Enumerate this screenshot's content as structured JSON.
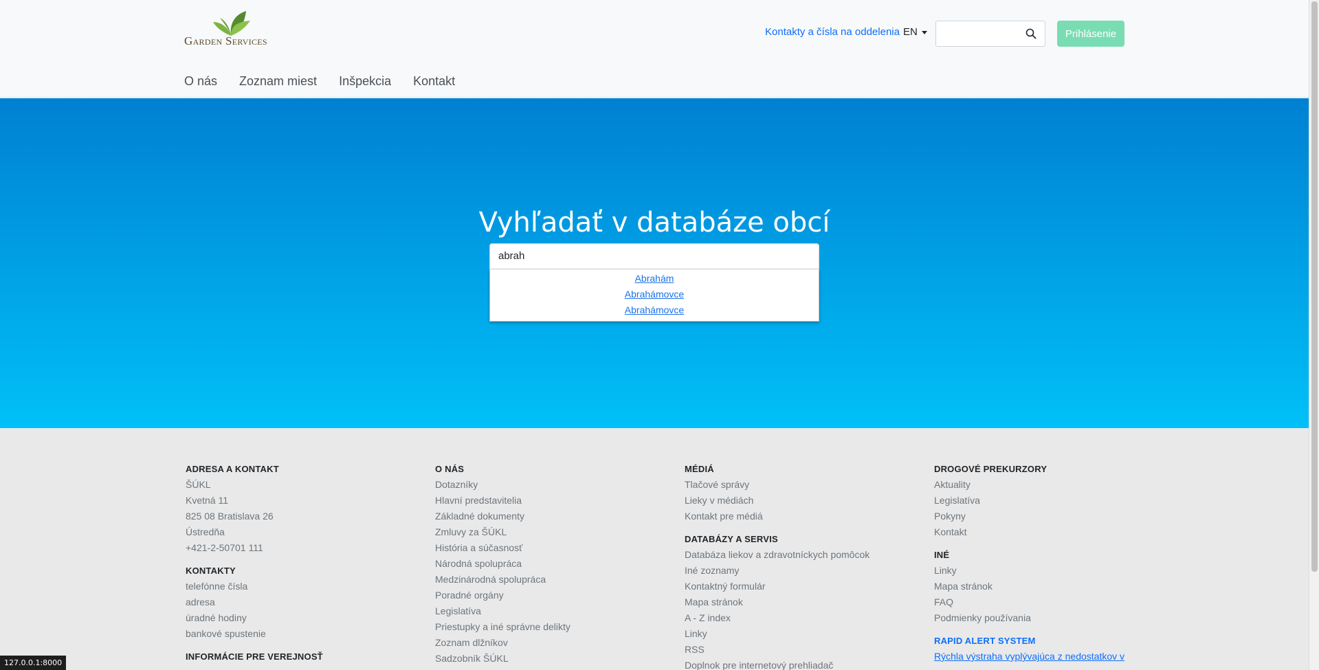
{
  "brand": {
    "logo_text": "Garden Services"
  },
  "header": {
    "contacts_link": "Kontakty a čísla na oddelenia",
    "language": "EN",
    "search_placeholder": "",
    "login_label": "Prihlásenie"
  },
  "nav": {
    "items": [
      "O nás",
      "Zoznam miest",
      "Inšpekcia",
      "Kontakt"
    ]
  },
  "hero": {
    "title": "Vyhľadať v databáze obcí",
    "search_value": "abrah",
    "suggestions": [
      "Abrahám",
      "Abrahámovce",
      "Abrahámovce"
    ]
  },
  "footer": {
    "col1": {
      "group1": {
        "title": "ADRESA A KONTAKT",
        "items": [
          "ŠÚKL",
          "Kvetná 11",
          "825 08 Bratislava 26",
          "Ústredňa",
          "+421-2-50701 111"
        ]
      },
      "group2": {
        "title": "KONTAKTY",
        "items": [
          "telefónne čísla",
          "adresa",
          "úradné hodiny",
          "bankové spustenie"
        ]
      },
      "group3": {
        "title": "INFORMÁCIE PRE VEREJNOSŤ"
      }
    },
    "col2": {
      "group1": {
        "title": "O NÁS",
        "items": [
          "Dotazníky",
          "Hlavní predstavitelia",
          "Základné dokumenty",
          "Zmluvy za ŠÚKL",
          "História a súčasnosť",
          "Národná spolupráca",
          "Medzinárodná spolupráca",
          "Poradné orgány",
          "Legislatíva",
          "Priestupky a iné správne delikty",
          "Zoznam dlžníkov",
          "Sadzobník ŠÚKL"
        ]
      }
    },
    "col3": {
      "group1": {
        "title": "MÉDIÁ",
        "items": [
          "Tlačové správy",
          "Lieky v médiách",
          "Kontakt pre médiá"
        ]
      },
      "group2": {
        "title": "DATABÁZY A SERVIS",
        "items": [
          "Databáza liekov a zdravotníckych pomôcok",
          "Iné zoznamy",
          "Kontaktný formulár",
          "Mapa stránok",
          "A - Z index",
          "Linky",
          "RSS",
          "Doplnok pre internetový prehliadač"
        ]
      }
    },
    "col4": {
      "group1": {
        "title": "DROGOVÉ PREKURZORY",
        "items": [
          "Aktuality",
          "Legislatíva",
          "Pokyny",
          "Kontakt"
        ]
      },
      "group2": {
        "title": "INÉ",
        "items": [
          "Linky",
          "Mapa stránok",
          "FAQ",
          "Podmienky používania"
        ]
      },
      "group3": {
        "title": "RAPID ALERT SYSTEM",
        "link": "Rýchla výstraha vyplývajúca z nedostatkov v"
      }
    }
  },
  "status_bar": "127.0.0.1:8000",
  "colors": {
    "hero_top": "#0080d2",
    "hero_bottom": "#00c0f8",
    "login_button": "#79dcb2",
    "link": "#0d6efd"
  },
  "icons": {
    "search": "search-icon",
    "logo": "leaf-logo-icon",
    "dropdown": "caret-down-icon"
  }
}
